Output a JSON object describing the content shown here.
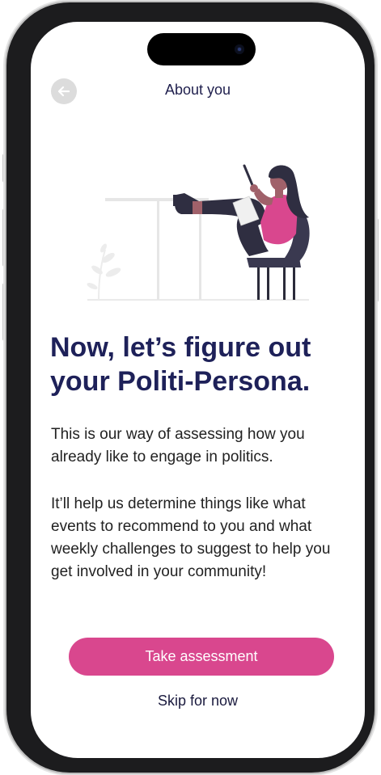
{
  "header": {
    "title": "About you",
    "back_icon": "arrow-left-icon"
  },
  "headline": "Now, let’s figure out your Politi-Persona.",
  "body": {
    "paragraph_1": "This is our way of assessing how you already like to engage in politics.",
    "paragraph_2": "It’ll help us determine things like what events to recommend to you and what weekly challenges to suggest to help you get involved in your community!"
  },
  "actions": {
    "primary_label": "Take assessment",
    "secondary_label": "Skip for now"
  },
  "colors": {
    "accent": "#d9478e",
    "headline": "#1e2159",
    "back_button_bg": "#dcdcdc"
  }
}
